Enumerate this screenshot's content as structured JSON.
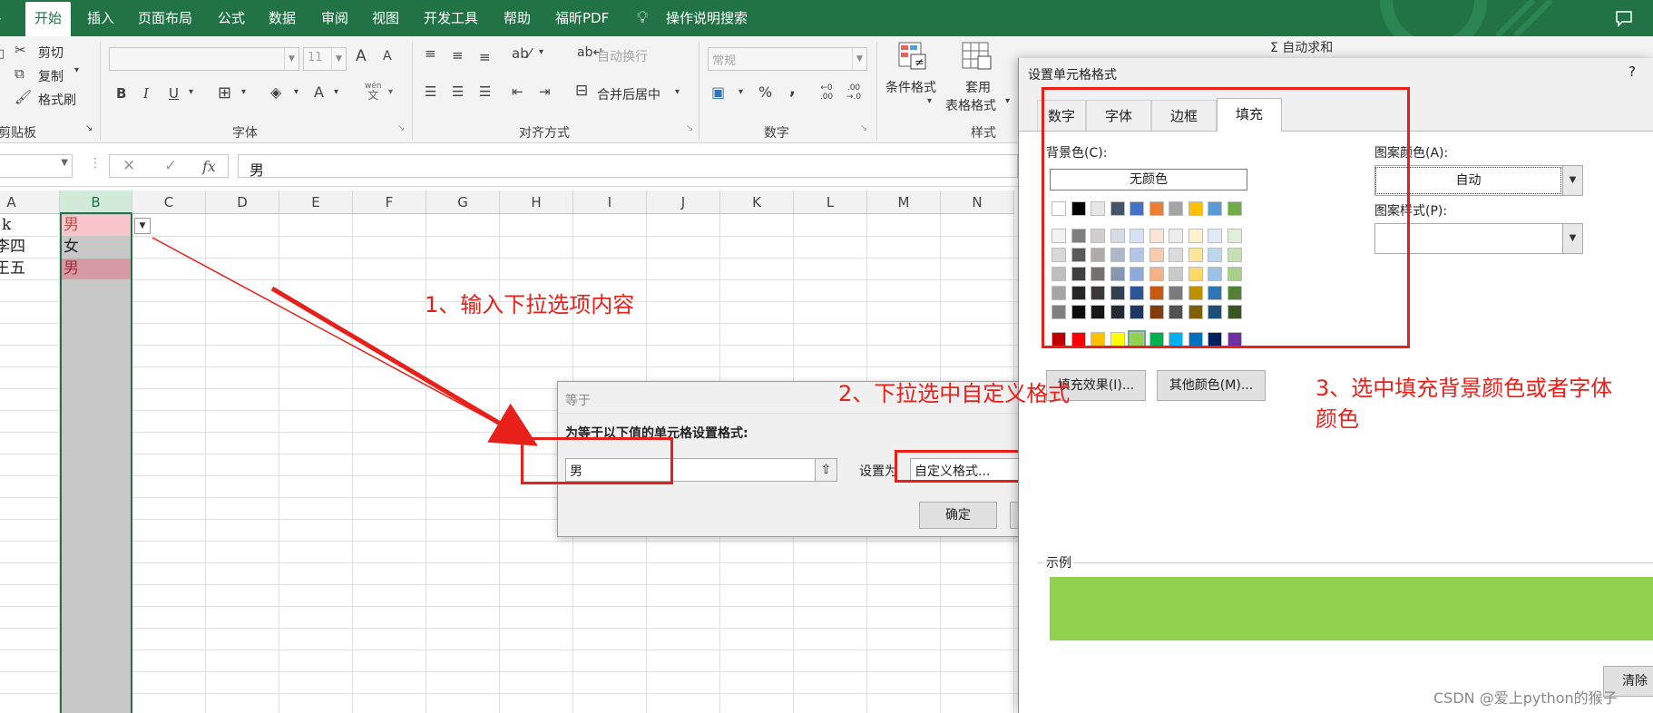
{
  "ribbon_tabs": [
    {
      "label": "开始",
      "active": true
    },
    {
      "label": "插入"
    },
    {
      "label": "页面布局"
    },
    {
      "label": "公式"
    },
    {
      "label": "数据"
    },
    {
      "label": "审阅"
    },
    {
      "label": "视图"
    },
    {
      "label": "开发工具"
    },
    {
      "label": "帮助"
    },
    {
      "label": "福昕PDF"
    }
  ],
  "search": {
    "label": "操作说明搜索"
  },
  "clipboard": {
    "cut": "剪切",
    "copy": "复制",
    "format_painter": "格式刷",
    "group": "剪贴板"
  },
  "font": {
    "size": "11",
    "bold": "B",
    "italic": "I",
    "underline": "U",
    "group": "字体",
    "grow": "A",
    "shrink": "A",
    "phonetic_top": "wén",
    "phonetic_bottom": "文"
  },
  "alignment": {
    "wrap": "自动换行",
    "merge": "合并后居中",
    "group": "对齐方式"
  },
  "number": {
    "format": "常规",
    "percent": "%",
    "comma": ",",
    "group": "数字",
    "inc_dec": "←0 .00",
    "dec_dec": ".00 →.0"
  },
  "styles": {
    "conditional": "条件格式",
    "table_line1": "套用",
    "table_line2": "表格格式",
    "group": "样式"
  },
  "editing": {
    "autosum": "Σ 自动求和"
  },
  "formula_bar": {
    "fx": "fx",
    "value": "男"
  },
  "columns": [
    "A",
    "B",
    "C",
    "D",
    "E",
    "F",
    "G",
    "H",
    "I",
    "J",
    "K",
    "L",
    "M",
    "N"
  ],
  "cells": {
    "a1": "k",
    "a2": "李四",
    "a3": "王五",
    "b1": "男",
    "b2": "女",
    "b3": "男"
  },
  "annotations": {
    "step1": "1、输入下拉选项内容",
    "step2": "2、下拉选中自定义格式",
    "step3_line1": "3、选中填充背景颜色或者字体",
    "step3_line2": "颜色"
  },
  "equal_dialog": {
    "title": "等于",
    "prompt": "为等于以下值的单元格设置格式:",
    "value": "男",
    "set_as": "设置为",
    "format": "自定义格式...",
    "ok": "确定"
  },
  "format_dialog": {
    "title": "设置单元格格式",
    "help": "?",
    "tabs": [
      "数字",
      "字体",
      "边框",
      "填充"
    ],
    "active_tab": "填充",
    "bg_color_label": "背景色(C):",
    "no_color": "无颜色",
    "pattern_color_label": "图案颜色(A):",
    "pattern_color_value": "自动",
    "pattern_style_label": "图案样式(P):",
    "fill_effects": "填充效果(I)...",
    "more_colors": "其他颜色(M)...",
    "sample_label": "示例",
    "sample_color": "#92d050",
    "clear": "清除"
  },
  "palette": {
    "theme_top": [
      "#ffffff",
      "#000000",
      "#e7e6e6",
      "#44546a",
      "#4472c4",
      "#ed7d31",
      "#a5a5a5",
      "#ffc000",
      "#5b9bd5",
      "#70ad47"
    ],
    "theme_shades": [
      [
        "#f2f2f2",
        "#7f7f7f",
        "#d0cece",
        "#d6dce4",
        "#d9e2f3",
        "#fbe5d5",
        "#ededed",
        "#fff2cc",
        "#deebf6",
        "#e2efd9"
      ],
      [
        "#d8d8d8",
        "#595959",
        "#aeabab",
        "#adb9ca",
        "#b4c6e7",
        "#f7cbac",
        "#dbdbdb",
        "#fee599",
        "#bdd7ee",
        "#c5e0b3"
      ],
      [
        "#bfbfbf",
        "#3f3f3f",
        "#757070",
        "#8496b0",
        "#8eaadb",
        "#f4b183",
        "#c9c9c9",
        "#ffd965",
        "#9cc3e5",
        "#a8d08d"
      ],
      [
        "#a5a5a5",
        "#262626",
        "#3a3838",
        "#323f4f",
        "#2f5496",
        "#c55a11",
        "#7b7b7b",
        "#bf9000",
        "#2e75b5",
        "#538135"
      ],
      [
        "#7f7f7f",
        "#0c0c0c",
        "#171616",
        "#222a35",
        "#1e3864",
        "#833c0b",
        "#525252",
        "#7f6000",
        "#1e4e79",
        "#375623"
      ]
    ],
    "standard": [
      "#c00000",
      "#ff0000",
      "#ffc000",
      "#ffff00",
      "#92d050",
      "#00b050",
      "#00b0f0",
      "#0070c0",
      "#002060",
      "#7030a0"
    ]
  },
  "watermark": "CSDN @爱上python的猴子"
}
